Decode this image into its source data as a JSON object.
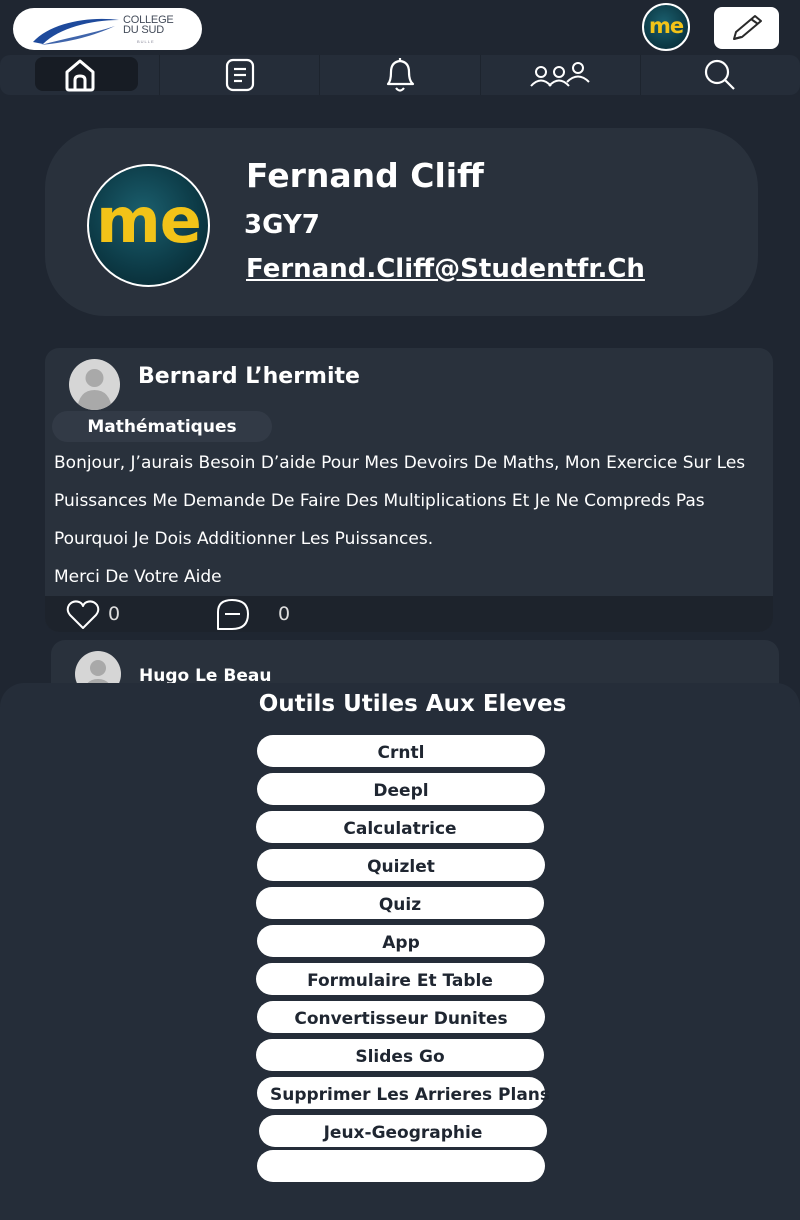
{
  "header": {
    "logo_line1": "COLLEGE",
    "logo_line2": "DU SUD",
    "logo_line3": "BULLE",
    "avatar_text": "me",
    "edit_icon": "pencil-icon"
  },
  "nav": {
    "items": [
      {
        "name": "home",
        "icon": "home-icon",
        "active": true
      },
      {
        "name": "notes",
        "icon": "notes-icon"
      },
      {
        "name": "notifications",
        "icon": "bell-icon"
      },
      {
        "name": "groups",
        "icon": "group-icon"
      },
      {
        "name": "search",
        "icon": "search-icon"
      }
    ]
  },
  "profile": {
    "avatar_text": "me",
    "name": "Fernand Cliff",
    "class": "3GY7",
    "email": "Fernand.Cliff@Studentfr.Ch"
  },
  "posts": [
    {
      "author": "Bernard L’hermite",
      "tag": "Mathématiques",
      "body_lines": [
        "Bonjour, J’aurais Besoin D’aide Pour Mes Devoirs De Maths, Mon Exercice Sur Les",
        "Puissances Me Demande De Faire Des Multiplications Et Je Ne Compreds Pas",
        "Pourquoi Je Dois Additionner Les Puissances.",
        "Merci De Votre Aide"
      ],
      "likes": "0",
      "comments": "0"
    },
    {
      "author": "Hugo Le Beau"
    }
  ],
  "tools": {
    "title": "Outils Utiles Aux Eleves",
    "items": [
      "Crntl",
      "Deepl",
      "Calculatrice",
      "Quizlet",
      "Quiz",
      "App",
      "Formulaire Et Table",
      "Convertisseur Dunites",
      "Slides Go",
      "Supprimer Les Arrieres Plans",
      "Jeux-Geographie",
      ""
    ]
  },
  "colors": {
    "background": "#1f2631",
    "card": "#29313c",
    "accent_yellow": "#f2c318",
    "logo_blue": "#1e4a9c"
  }
}
